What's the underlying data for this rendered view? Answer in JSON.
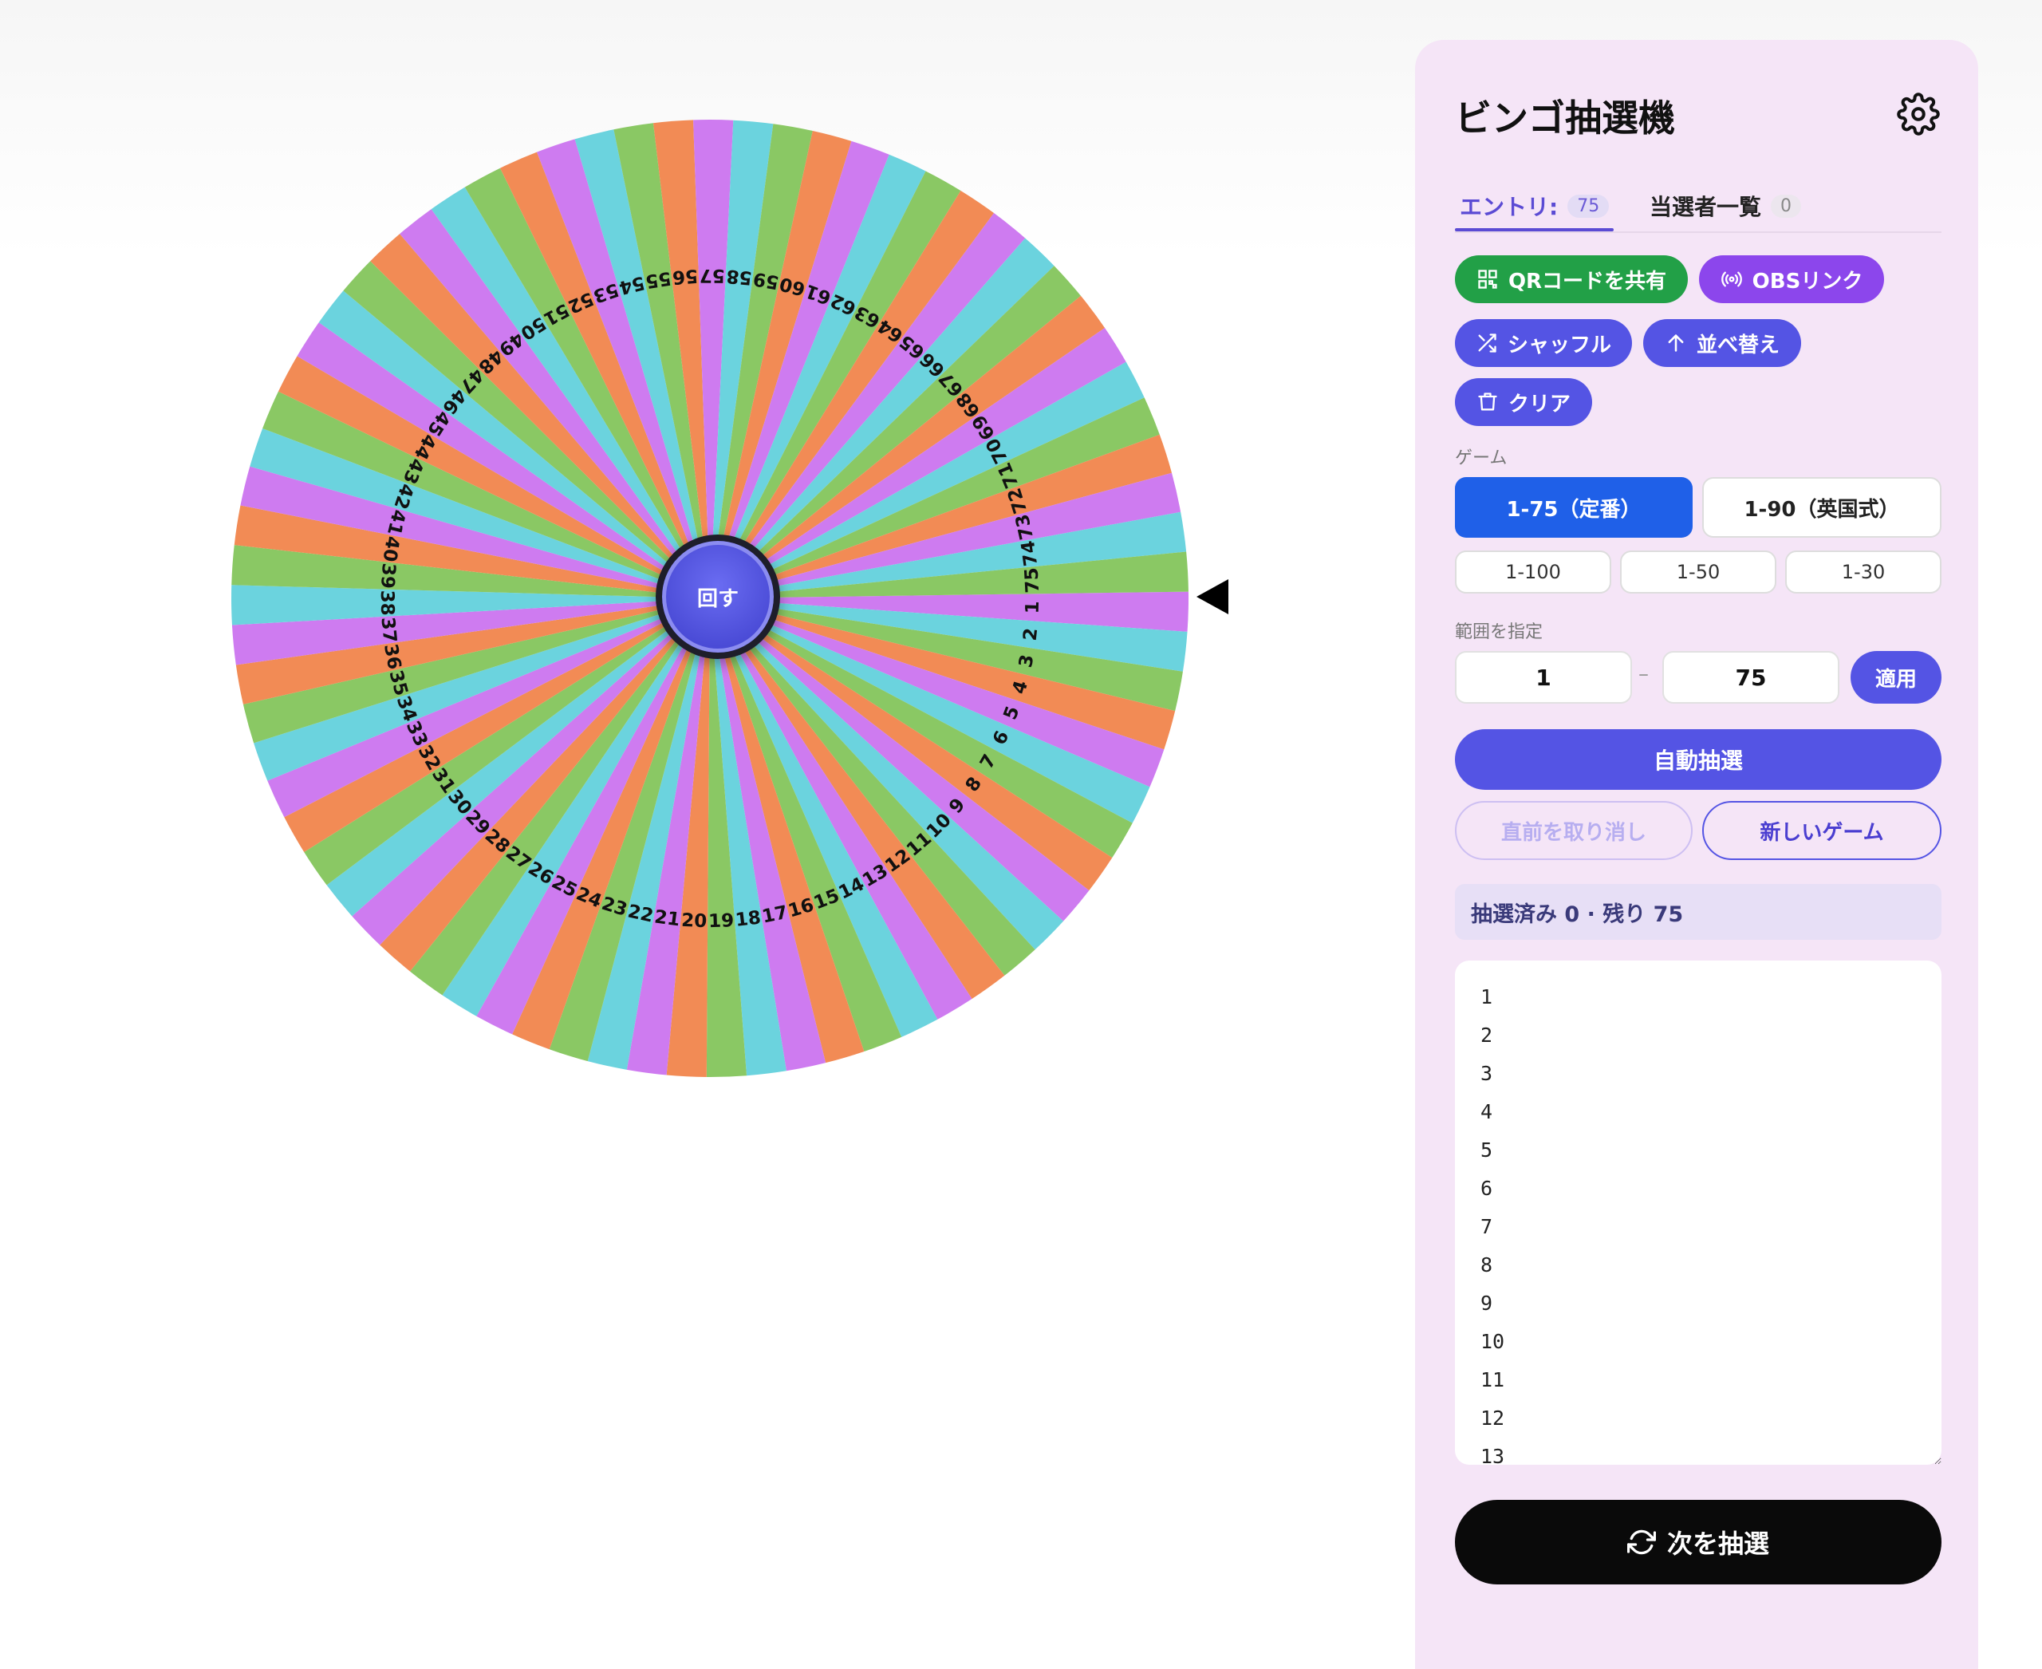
{
  "wheel": {
    "numbers": [
      1,
      2,
      3,
      4,
      5,
      6,
      7,
      8,
      9,
      10,
      11,
      12,
      13,
      14,
      15,
      16,
      17,
      18,
      19,
      20,
      21,
      22,
      23,
      24,
      25,
      26,
      27,
      28,
      29,
      30,
      31,
      32,
      33,
      34,
      35,
      36,
      37,
      38,
      39,
      40,
      41,
      42,
      43,
      44,
      45,
      46,
      47,
      48,
      49,
      50,
      51,
      52,
      53,
      54,
      55,
      56,
      57,
      58,
      59,
      60,
      61,
      62,
      63,
      64,
      65,
      66,
      67,
      68,
      69,
      70,
      71,
      72,
      73,
      74,
      75
    ],
    "colors": [
      "#ce7bf0",
      "#6bd3de",
      "#8ac864",
      "#f28b55"
    ],
    "spin_label": "回す"
  },
  "panel": {
    "title": "ビンゴ抽選機",
    "tabs": {
      "entries_label": "エントリ:",
      "entries_count": "75",
      "winners_label": "当選者一覧",
      "winners_count": "0"
    },
    "actions": {
      "qr_label": "QRコードを共有",
      "obs_label": "OBSリンク",
      "shuffle_label": "シャッフル",
      "sort_label": "並べ替え",
      "clear_label": "クリア"
    },
    "game": {
      "label": "ゲーム",
      "options": [
        "1-75（定番）",
        "1-90（英国式）",
        "1-100",
        "1-50",
        "1-30"
      ]
    },
    "range": {
      "label": "範囲を指定",
      "start": "1",
      "end": "75",
      "dash": "–",
      "apply_label": "適用"
    },
    "auto_draw_label": "自動抽選",
    "undo_label": "直前を取り消し",
    "new_game_label": "新しいゲーム",
    "status": "抽選済み 0 · 残り 75",
    "entries_text": "1\n2\n3\n4\n5\n6\n7\n8\n9\n10\n11\n12\n13",
    "draw_next_label": "次を抽選"
  }
}
